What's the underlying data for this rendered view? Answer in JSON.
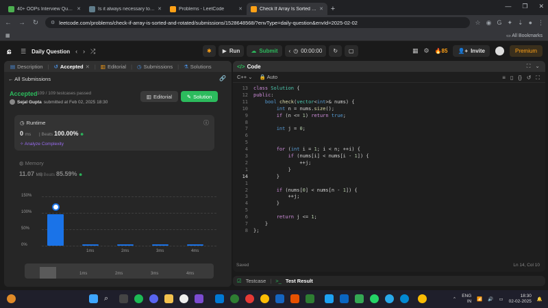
{
  "browser": {
    "tabs": [
      {
        "title": "40+ OOPs Interview Questions",
        "color": "#4caf50",
        "active": false
      },
      {
        "title": "Is it always necessary to create",
        "color": "#607d8b",
        "active": false
      },
      {
        "title": "Problems - LeetCode",
        "color": "#ffa116",
        "active": false
      },
      {
        "title": "Check If Array Is Sorted and Ro",
        "color": "#ffa116",
        "active": true
      }
    ],
    "url": "leetcode.com/problems/check-if-array-is-sorted-and-rotated/submissions/1528648568/?envType=daily-question&envId=2025-02-02",
    "bookmarks_label": "All Bookmarks"
  },
  "lcnav": {
    "title": "Daily Question",
    "run": "Run",
    "submit": "Submit",
    "timer": "00:00:00",
    "streak": "85",
    "invite": "Invite",
    "premium": "Premium"
  },
  "left": {
    "tabs": [
      "Description",
      "Accepted",
      "Editorial",
      "Submissions",
      "Solutions"
    ],
    "all_submissions": "All Submissions",
    "status": "Accepted",
    "passed": "109 / 109 testcases passed",
    "user": "Sejal Gupta",
    "submitted": "submitted at Feb 02, 2025 18:30",
    "editorial_btn": "Editorial",
    "solution_btn": "Solution",
    "runtime": {
      "label": "Runtime",
      "value": "0",
      "unit": "ms",
      "beats_label": "Beats",
      "beats": "100.00%",
      "analyze": "Analyze Complexity"
    },
    "memory": {
      "label": "Memory",
      "value": "11.07",
      "unit": "MB",
      "beats_label": "Beats",
      "beats": "85.59%"
    }
  },
  "chart_data": {
    "type": "bar",
    "categories": [
      "0ms",
      "1ms",
      "2ms",
      "3ms",
      "4ms"
    ],
    "values": [
      95,
      2,
      2,
      2,
      2
    ],
    "ylim": [
      0,
      150
    ],
    "yticks": [
      "150%",
      "100%",
      "50%",
      "0%"
    ],
    "xticks_shown": [
      "",
      "1ms",
      "2ms",
      "3ms",
      "4ms"
    ],
    "highlight_index": 0,
    "color": "#1a73e8"
  },
  "code": {
    "tab": "Code",
    "language": "C++",
    "mode": "Auto",
    "lines": [
      {
        "n": "13",
        "t": "class Solution {"
      },
      {
        "n": "12",
        "t": "public:"
      },
      {
        "n": "11",
        "t": "    bool check(vector<int>& nums) {"
      },
      {
        "n": "10",
        "t": "        int n = nums.size();"
      },
      {
        "n": "9",
        "t": "        if (n <= 1) return true;"
      },
      {
        "n": "8",
        "t": ""
      },
      {
        "n": "7",
        "t": "        int j = 0;"
      },
      {
        "n": "6",
        "t": ""
      },
      {
        "n": "5",
        "t": ""
      },
      {
        "n": "4",
        "t": "        for (int i = 1; i < n; ++i) {"
      },
      {
        "n": "3",
        "t": "            if (nums[i] < nums[i - 1]) {"
      },
      {
        "n": "2",
        "t": "                ++j;"
      },
      {
        "n": "1",
        "t": "            }"
      },
      {
        "n": "14",
        "t": "        }"
      },
      {
        "n": "1",
        "t": ""
      },
      {
        "n": "2",
        "t": "        if (nums[0] < nums[n - 1]) {"
      },
      {
        "n": "3",
        "t": "            ++j;"
      },
      {
        "n": "4",
        "t": "        }"
      },
      {
        "n": "5",
        "t": ""
      },
      {
        "n": "6",
        "t": "        return j <= 1;"
      },
      {
        "n": "7",
        "t": "    }"
      },
      {
        "n": "8",
        "t": "};"
      }
    ],
    "saved": "Saved",
    "position": "Ln 14, Col 10"
  },
  "bottom": {
    "testcase": "Testcase",
    "test_result": "Test Result"
  },
  "taskbar": {
    "lang": "ENG",
    "region": "IN",
    "time": "18:30",
    "date": "02-02-2025"
  }
}
